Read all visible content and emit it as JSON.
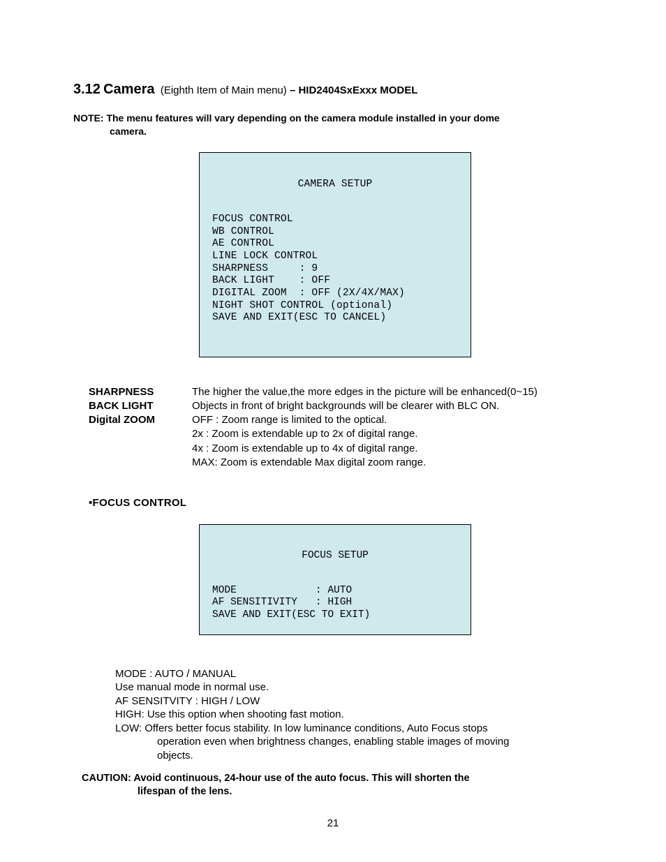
{
  "heading": {
    "number": "3.12",
    "title": "Camera",
    "paren": "(Eighth Item of Main menu)",
    "dash": "–",
    "model": "HID2404SxExxx MODEL"
  },
  "note": {
    "label": "NOTE:",
    "text1": "The menu features will vary depending on the camera module installed in your dome",
    "text2": "camera."
  },
  "screen1": {
    "title": "CAMERA SETUP",
    "l1": "FOCUS CONTROL",
    "l2": "WB CONTROL",
    "l3": "AE CONTROL",
    "l4": "LINE LOCK CONTROL",
    "l5": "SHARPNESS     : 9",
    "l6": "BACK LIGHT    : OFF",
    "l7": "DIGITAL ZOOM  : OFF (2X/4X/MAX)",
    "l8": "NIGHT SHOT CONTROL (optional)",
    "l9": "SAVE AND EXIT(ESC TO CANCEL)"
  },
  "defs": {
    "sharpness_label": "SHARPNESS",
    "sharpness_desc": "The higher the value,the more edges in the picture will be enhanced(0~15)",
    "backlight_label": "BACK LIGHT",
    "backlight_desc": "Objects in front of bright backgrounds will be clearer with BLC ON.",
    "dzoom_label": "Digital ZOOM",
    "dzoom_off": "OFF : Zoom range is limited to the optical.",
    "dzoom_2x": "2x    : Zoom is extendable up to  2x of digital range.",
    "dzoom_4x": "4x    : Zoom is extendable up to  4x of digital range.",
    "dzoom_max": "MAX: Zoom is extendable Max digital zoom range."
  },
  "subheading": "•FOCUS CONTROL",
  "screen2": {
    "title": "FOCUS SETUP",
    "l1": "MODE             : AUTO",
    "l2": "AF SENSITIVITY   : HIGH",
    "l3": "SAVE AND EXIT(ESC TO EXIT)"
  },
  "focus_text": {
    "t1": "MODE :  AUTO / MANUAL",
    "t2": "Use manual mode in normal use.",
    "t3": "AF SENSITVITY       : HIGH / LOW",
    "t4": "HIGH: Use this option when shooting fast motion.",
    "t5a": "LOW: Offers better focus stability. In low luminance conditions, Auto Focus stops",
    "t5b": "operation even when brightness changes, enabling stable images of moving",
    "t5c": "objects."
  },
  "caution": {
    "label": "CAUTION:",
    "t1": "Avoid continuous, 24-hour use of the auto focus.  This will shorten the",
    "t2": "lifespan of the lens."
  },
  "page_number": "21"
}
